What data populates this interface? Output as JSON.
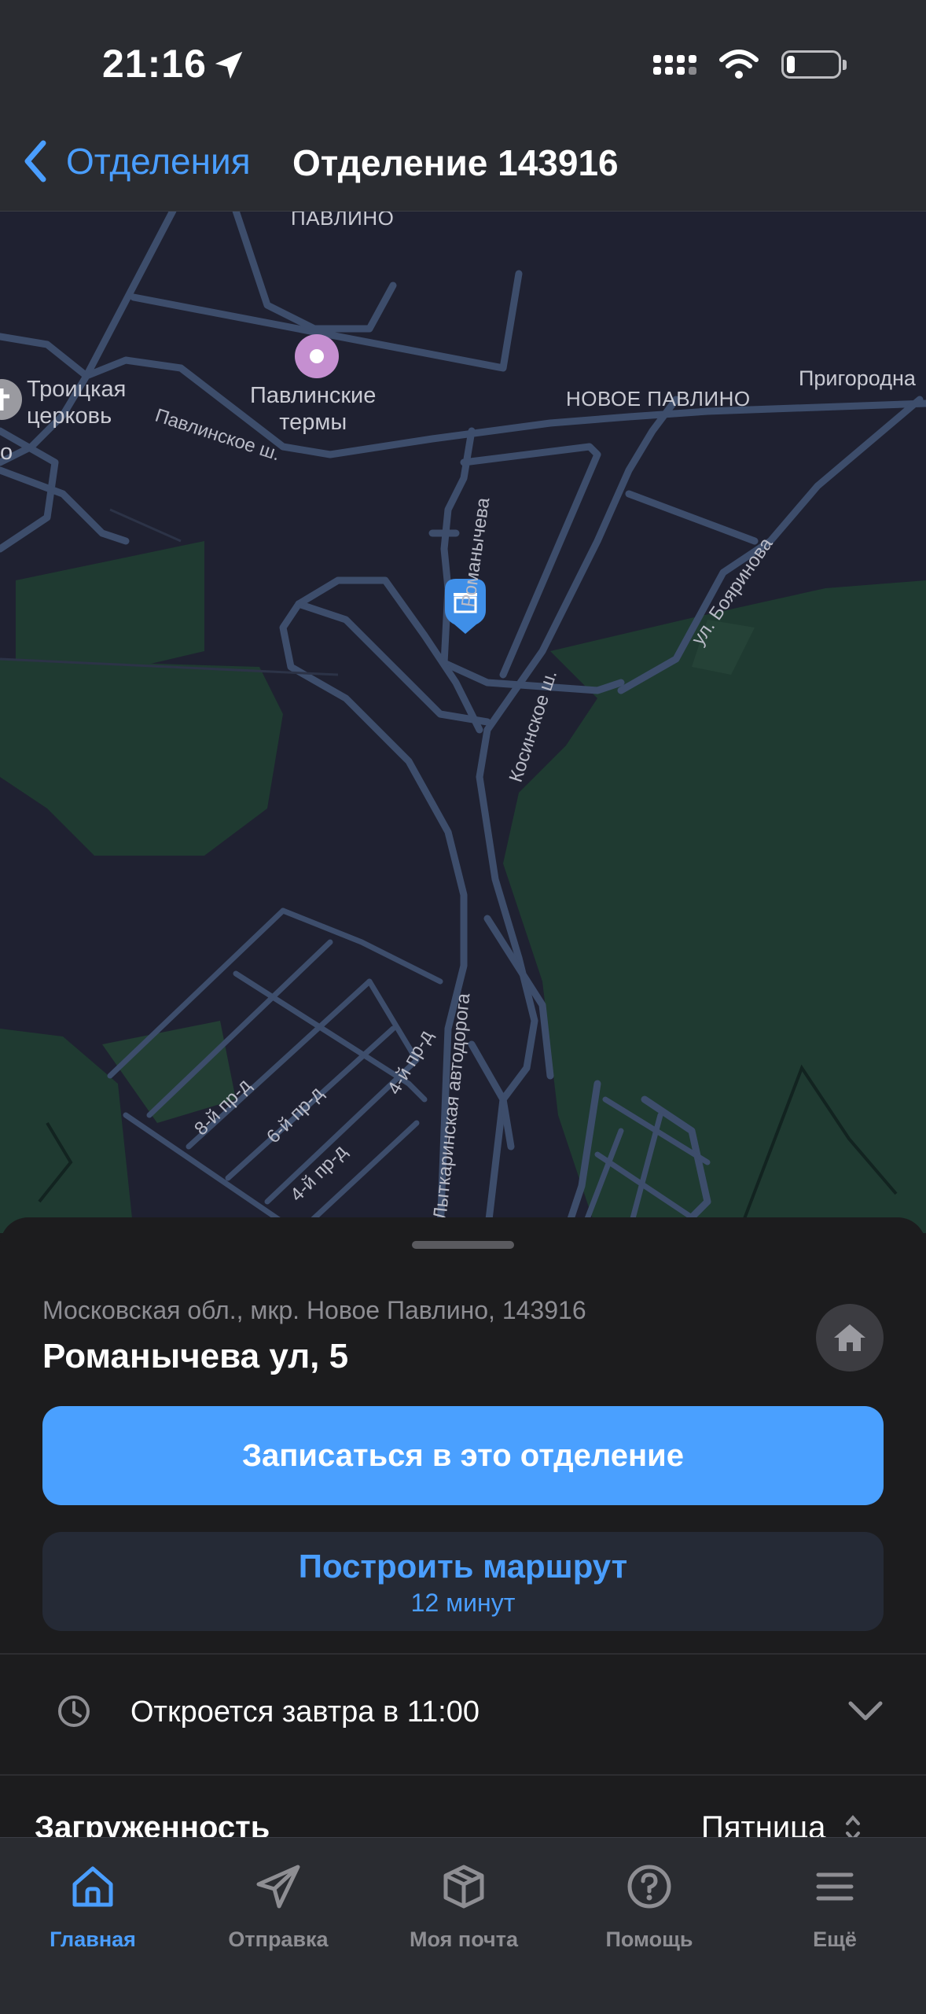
{
  "status_bar": {
    "time": "21:16"
  },
  "nav": {
    "back_label": "Отделения",
    "title": "Отделение 143916"
  },
  "map": {
    "places": {
      "pavlino_top": "ПАВЛИНО",
      "pavlinskie_termy_1": "Павлинские",
      "pavlinskie_termy_2": "термы",
      "troitskaya_1": "Троицкая",
      "troitskaya_2": "церковь",
      "left_edge": "о",
      "novoe_pavlino": "НОВОЕ ПАВЛИНО",
      "prigorodnaya": "Пригородна"
    },
    "roads": {
      "pavlinskoe": "Павлинское ш.",
      "romanycheva": "Романычева",
      "kosinskoe": "Косинское ш.",
      "boyarinova": "ул. Бояринова",
      "lytkarinskaya": "о-Лыткаринская автодорога",
      "pr8": "8-й пр-д",
      "pr6": "6-й пр-д",
      "pr4a": "4-й пр-д",
      "pr4b": "4-й пр-д"
    }
  },
  "sheet": {
    "address_sub": "Московская обл., мкр. Новое Павлино, 143916",
    "address_main": "Романычева ул, 5",
    "primary_button": "Записаться в это отделение",
    "route_button": "Построить маршрут",
    "route_time": "12 минут",
    "hours": "Откроется завтра в 11:00",
    "load_title": "Загруженность",
    "load_day": "Пятница"
  },
  "tabs": [
    {
      "label": "Главная",
      "icon": "home-icon",
      "active": true
    },
    {
      "label": "Отправка",
      "icon": "send-icon",
      "active": false
    },
    {
      "label": "Моя почта",
      "icon": "box-icon",
      "active": false
    },
    {
      "label": "Помощь",
      "icon": "help-icon",
      "active": false
    },
    {
      "label": "Ещё",
      "icon": "menu-icon",
      "active": false
    }
  ],
  "colors": {
    "accent": "#4a9eff",
    "background": "#1c1c1e",
    "map_bg": "#1f2131",
    "map_green": "#1f3a31",
    "roads": "#3d4d6b"
  }
}
